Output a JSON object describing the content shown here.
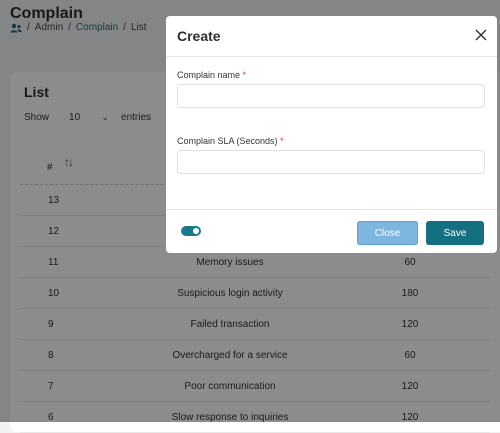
{
  "page": {
    "title": "Complain",
    "breadcrumb": {
      "admin": "Admin",
      "sep1": "/",
      "section": "Complain",
      "sep2": "/",
      "current": "List"
    }
  },
  "list": {
    "title": "List",
    "show_label": "Show",
    "page_size": "10",
    "entries_label": "entries",
    "columns": {
      "num": "#"
    },
    "rows": [
      {
        "id": "13",
        "name": "",
        "sla": ""
      },
      {
        "id": "12",
        "name": "",
        "sla": ""
      },
      {
        "id": "11",
        "name": "Memory issues",
        "sla": "60"
      },
      {
        "id": "10",
        "name": "Suspicious login activity",
        "sla": "180"
      },
      {
        "id": "9",
        "name": "Failed transaction",
        "sla": "120"
      },
      {
        "id": "8",
        "name": "Overcharged for a service",
        "sla": "60"
      },
      {
        "id": "7",
        "name": "Poor communication",
        "sla": "120"
      },
      {
        "id": "6",
        "name": "Slow response to inquiries",
        "sla": "120"
      }
    ]
  },
  "modal": {
    "title": "Create",
    "fields": {
      "name": {
        "label": "Complain name",
        "required": "*",
        "value": ""
      },
      "sla": {
        "label": "Complain SLA (Seconds)",
        "required": "*",
        "value": ""
      }
    },
    "toggle_on": true,
    "close_label": "Close",
    "save_label": "Save"
  },
  "colors": {
    "accent": "#146f80",
    "close_button": "#7fb6df",
    "link": "#1c6f85",
    "required": "#d33333"
  },
  "icons": {
    "breadcrumb": "users-icon",
    "sort": "sort-icon",
    "select": "chevron-down-icon",
    "close": "close-icon"
  }
}
